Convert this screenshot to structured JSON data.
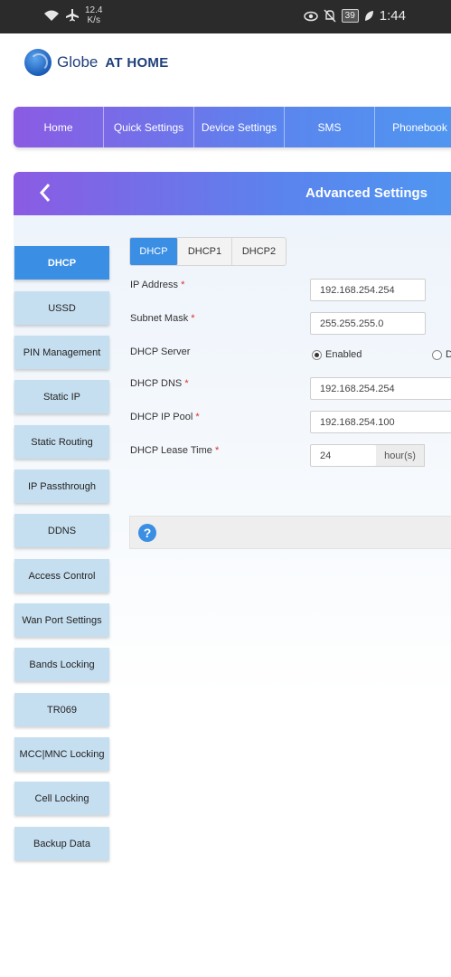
{
  "status_bar": {
    "speed_value": "12.4",
    "speed_unit": "K/s",
    "battery": "39",
    "time": "1:44",
    "icons": [
      "wifi-icon",
      "airplane-icon",
      "eye-icon",
      "bell-off-icon",
      "battery-icon",
      "leaf-icon"
    ]
  },
  "logo": {
    "brand": "Globe",
    "suffix": "AT HOME"
  },
  "nav": {
    "items": [
      {
        "label": "Home"
      },
      {
        "label": "Quick Settings"
      },
      {
        "label": "Device Settings"
      },
      {
        "label": "SMS"
      },
      {
        "label": "Phonebook"
      }
    ]
  },
  "header": {
    "back_icon": "chevron-left-icon",
    "title": "Advanced Settings"
  },
  "sidebar": {
    "items": [
      {
        "label": "DHCP",
        "active": true
      },
      {
        "label": "USSD"
      },
      {
        "label": "PIN Management"
      },
      {
        "label": "Static IP"
      },
      {
        "label": "Static Routing"
      },
      {
        "label": "IP Passthrough"
      },
      {
        "label": "DDNS"
      },
      {
        "label": "Access Control"
      },
      {
        "label": "Wan Port Settings"
      },
      {
        "label": "Bands Locking"
      },
      {
        "label": "TR069"
      },
      {
        "label": "MCC|MNC Locking"
      },
      {
        "label": "Cell Locking"
      },
      {
        "label": "Backup Data"
      }
    ]
  },
  "tabs": [
    {
      "label": "DHCP",
      "active": true
    },
    {
      "label": "DHCP1"
    },
    {
      "label": "DHCP2"
    }
  ],
  "form": {
    "ip_address": {
      "label": "IP Address",
      "required": "*",
      "value": "192.168.254.254"
    },
    "subnet_mask": {
      "label": "Subnet Mask",
      "required": "*",
      "value": "255.255.255.0"
    },
    "dhcp_server": {
      "label": "DHCP Server",
      "enabled_label": "Enabled",
      "disabled_label": "D",
      "selected": "Enabled"
    },
    "dhcp_dns": {
      "label": "DHCP DNS",
      "required": "*",
      "value": "192.168.254.254"
    },
    "dhcp_ip_pool": {
      "label": "DHCP IP Pool",
      "required": "*",
      "value": "192.168.254.100"
    },
    "dhcp_lease_time": {
      "label": "DHCP Lease Time",
      "required": "*",
      "value": "24",
      "unit": "hour(s)"
    }
  },
  "help": {
    "icon_label": "?"
  },
  "colors": {
    "accent": "#3a8ee3",
    "nav_gradient_start": "#8b5be3",
    "nav_gradient_end": "#4f97f0",
    "sidebar_item": "#c6dff0",
    "required": "#d9302c",
    "status_bar": "#2b2b2b"
  }
}
